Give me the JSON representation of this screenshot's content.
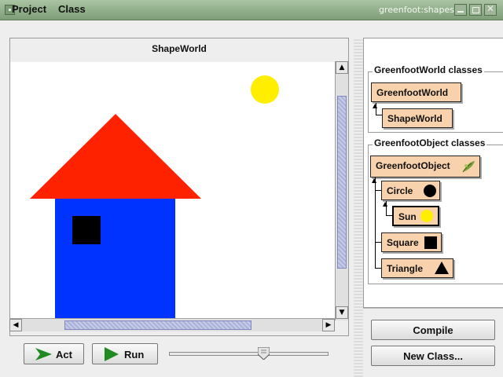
{
  "window": {
    "title": "greenfoot:shapes"
  },
  "menu": {
    "items": [
      "Project",
      "Class"
    ]
  },
  "world": {
    "title": "ShapeWorld"
  },
  "controls": {
    "act_label": "Act",
    "run_label": "Run",
    "speed_level": 0.6
  },
  "classes": {
    "world_group_label": "GreenfootWorld classes",
    "object_group_label": "GreenfootObject classes",
    "world_items": [
      "GreenfootWorld",
      "ShapeWorld"
    ],
    "object_items": [
      "GreenfootObject",
      "Circle",
      "Sun",
      "Square",
      "Triangle"
    ]
  },
  "actions": {
    "compile_label": "Compile",
    "new_class_label": "New Class..."
  },
  "colors": {
    "titlebar": "#8fae89",
    "class_box": "#f8d2ac",
    "house_roof": "#ff2200",
    "house_body": "#0033ff",
    "sun": "#ffee00",
    "arrow_green": "#1f8a1f"
  }
}
